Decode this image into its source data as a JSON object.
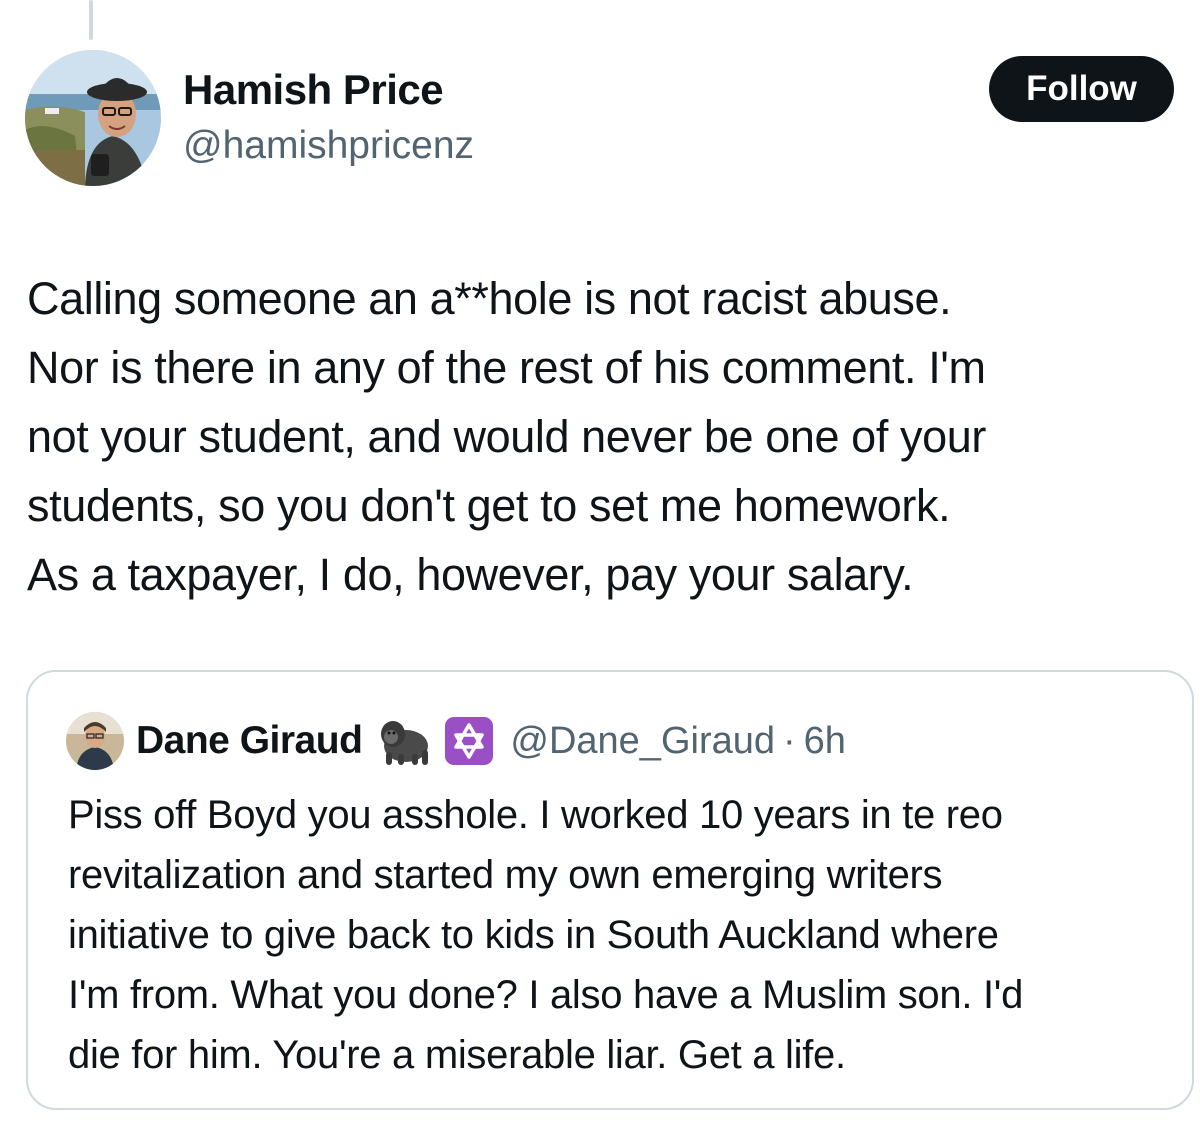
{
  "post": {
    "author_name": "Hamish Price",
    "author_handle": "@hamishpricenz",
    "follow_label": "Follow",
    "text_lines": [
      "Calling someone an a**hole is not racist abuse.",
      "Nor is there in any of the rest of his comment.  I'm",
      "not your student, and would never be one of your",
      "students, so you don't get to set me homework.",
      "As a taxpayer, I do, however, pay your salary."
    ]
  },
  "quote": {
    "author_name": "Dane Giraud",
    "emojis": [
      "gorilla-icon",
      "star-of-david-icon"
    ],
    "author_handle": "@Dane_Giraud",
    "separator": "·",
    "time": "6h",
    "text_lines": [
      "Piss off Boyd you asshole. I worked 10 years in te reo",
      "revitalization and started my own emerging writers",
      "initiative to give back to kids in South Auckland where",
      "I'm from. What you done? I also have a Muslim son. I'd",
      "die for him. You're a miserable liar. Get a life."
    ]
  },
  "colors": {
    "text": "#0f1419",
    "secondary_text": "#536471",
    "border": "#cfd9de",
    "follow_bg": "#0f1419",
    "follow_text": "#ffffff",
    "star_emoji_bg": "#9b4fc4"
  }
}
